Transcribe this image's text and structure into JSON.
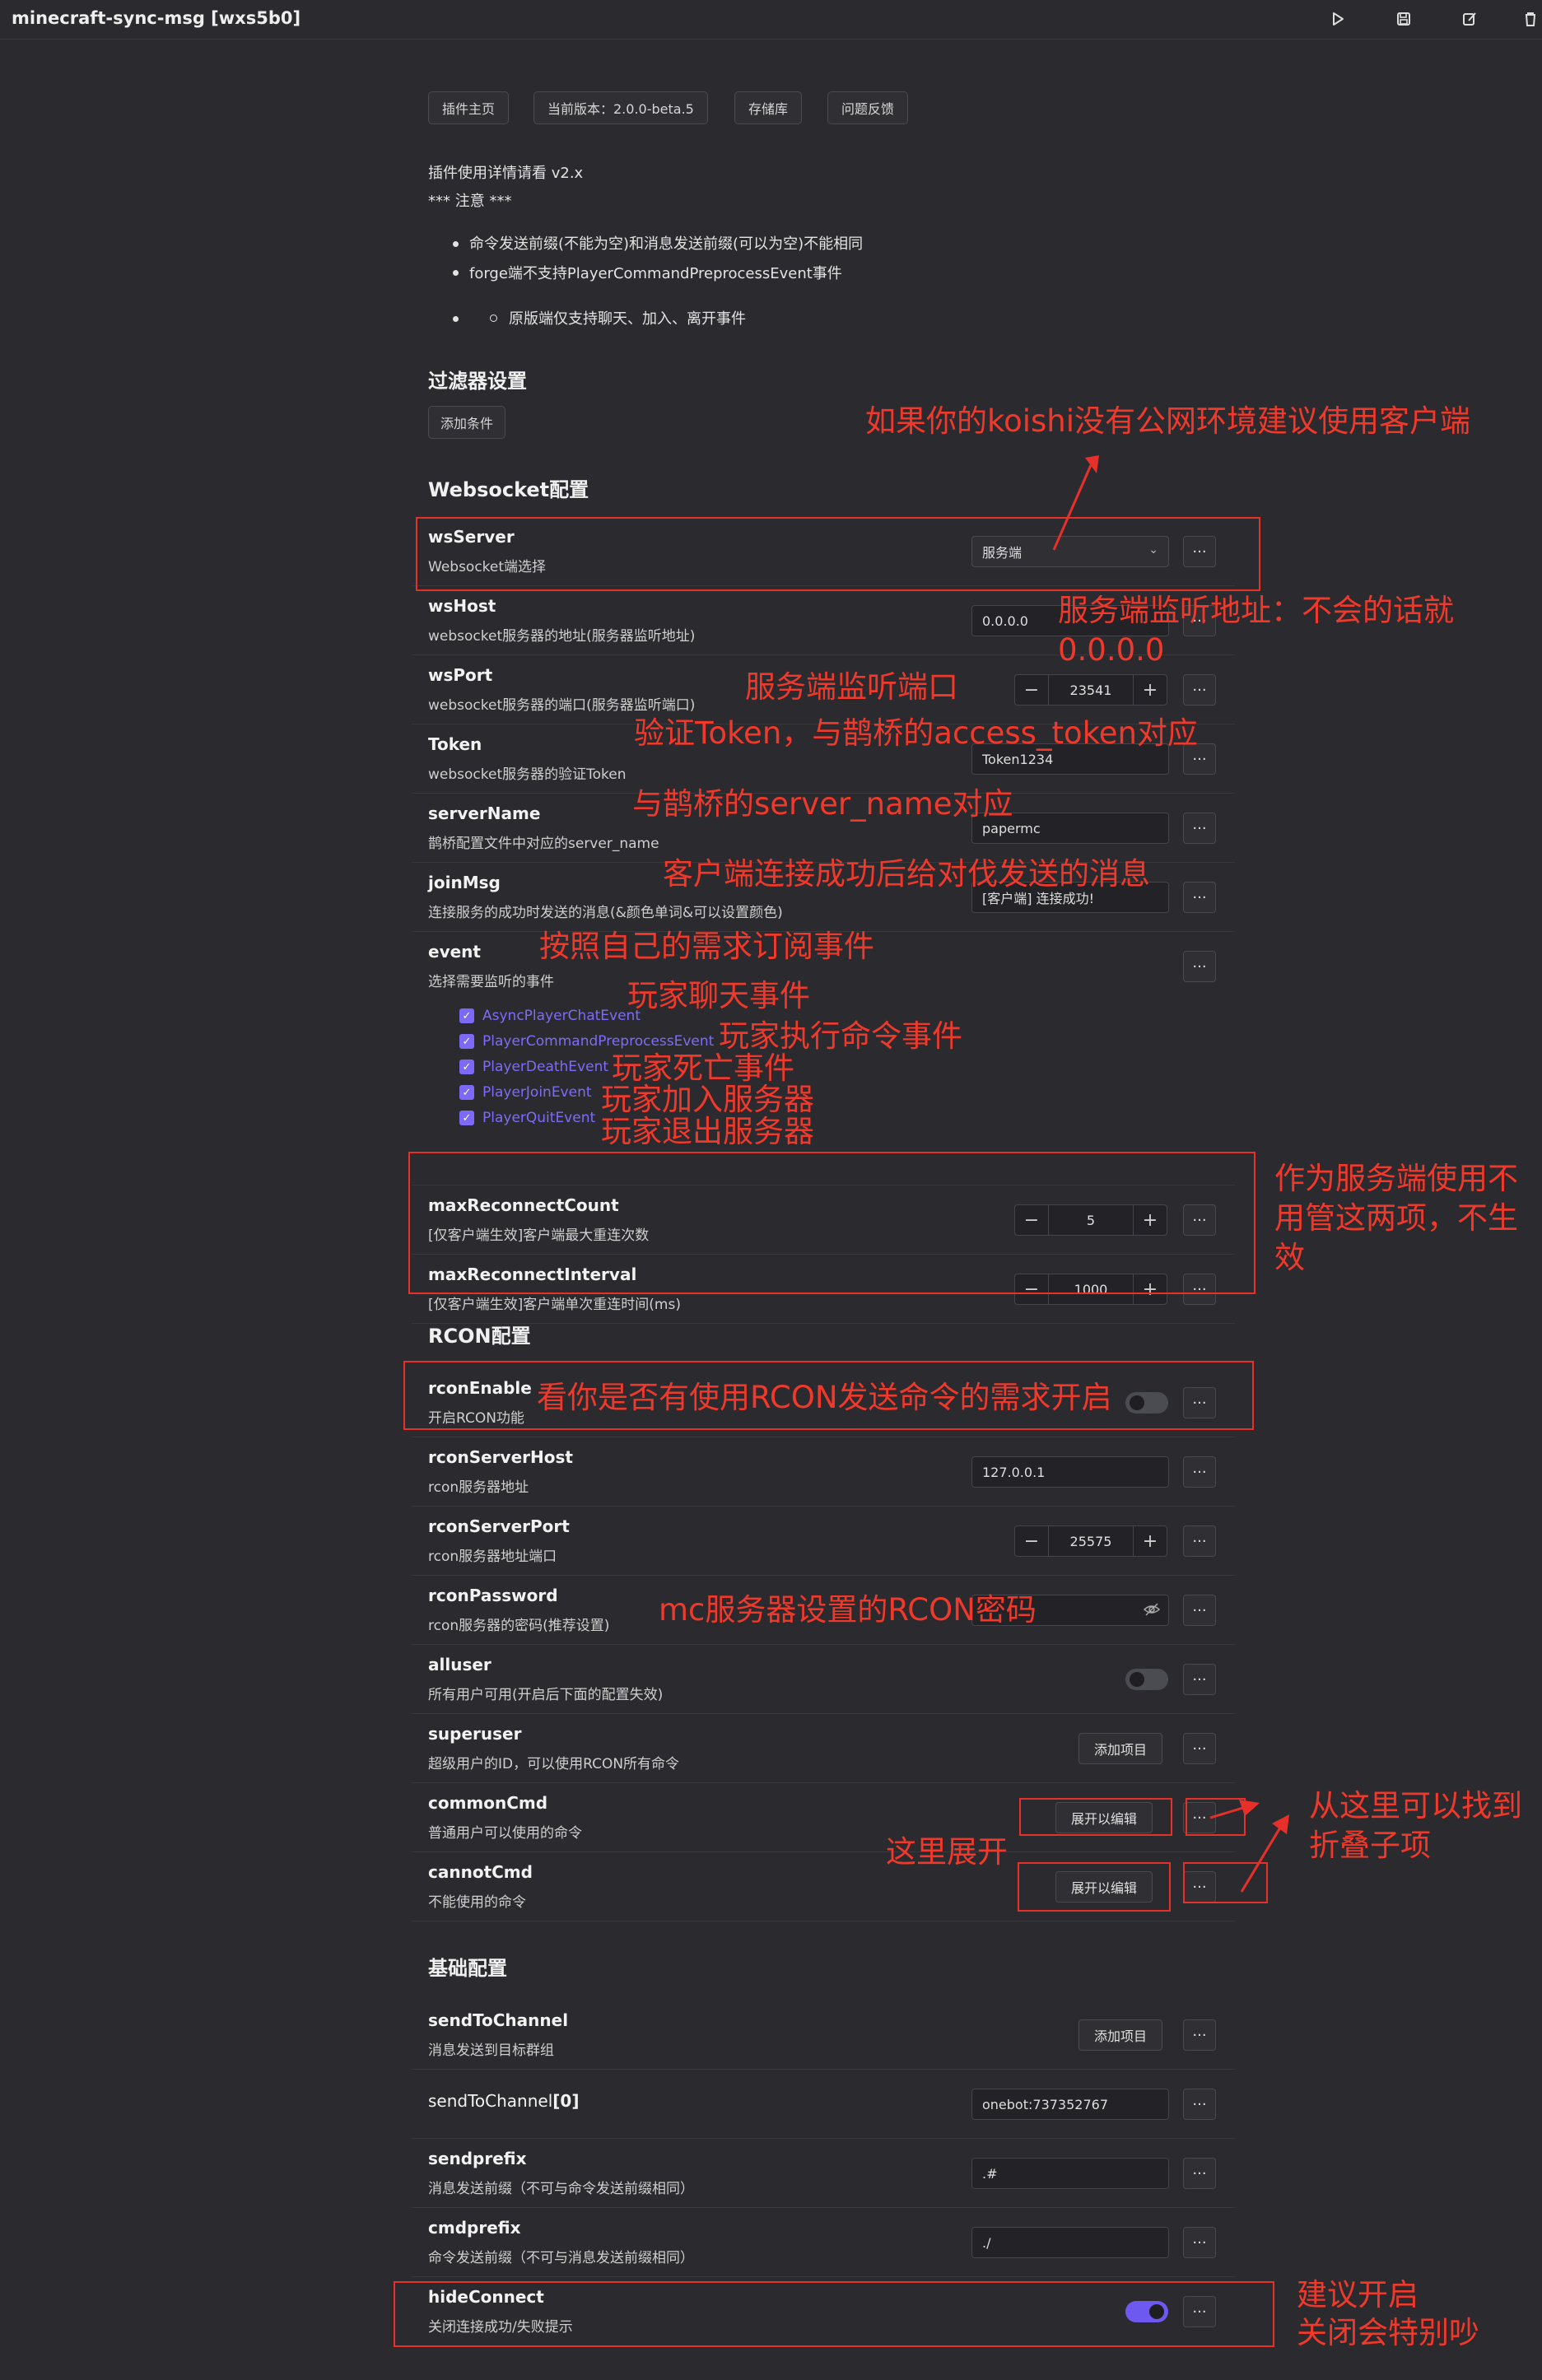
{
  "app": {
    "title": "minecraft-sync-msg [wxs5b0]"
  },
  "toolbar": {
    "run_icon": "play-icon",
    "save_icon": "save-icon",
    "edit_icon": "edit-icon",
    "delete_icon": "trash-icon"
  },
  "header_links": [
    "插件主页",
    "当前版本：2.0.0-beta.5",
    "存储库",
    "问题反馈"
  ],
  "intro": {
    "line1": "插件使用详情请看 v2.x",
    "line2": "*** 注意 ***",
    "bullets": [
      "命令发送前缀(不能为空)和消息发送前缀(可以为空)不能相同",
      "forge端不支持PlayerCommandPreprocessEvent事件"
    ],
    "sub_bullet": "原版端仅支持聊天、加入、离开事件"
  },
  "filter": {
    "title": "过滤器设置",
    "add_condition": "添加条件"
  },
  "websocket": {
    "title": "Websocket配置",
    "wsServer": {
      "name": "wsServer",
      "desc": "Websocket端选择",
      "value": "服务端"
    },
    "wsHost": {
      "name": "wsHost",
      "desc": "websocket服务器的地址(服务器监听地址)",
      "value": "0.0.0.0"
    },
    "wsPort": {
      "name": "wsPort",
      "desc": "websocket服务器的端口(服务器监听端口)",
      "value": "23541"
    },
    "Token": {
      "name": "Token",
      "desc": "websocket服务器的验证Token",
      "value": "Token1234"
    },
    "serverName": {
      "name": "serverName",
      "desc": "鹊桥配置文件中对应的server_name",
      "value": "papermc"
    },
    "joinMsg": {
      "name": "joinMsg",
      "desc": "连接服务的成功时发送的消息(&颜色单词&可以设置颜色)",
      "value": "[客户端] 连接成功!"
    },
    "event": {
      "name": "event",
      "desc": "选择需要监听的事件",
      "options": [
        "AsyncPlayerChatEvent",
        "PlayerCommandPreprocessEvent",
        "PlayerDeathEvent",
        "PlayerJoinEvent",
        "PlayerQuitEvent"
      ]
    },
    "maxReconnectCount": {
      "name": "maxReconnectCount",
      "desc": "[仅客户端生效]客户端最大重连次数",
      "value": "5"
    },
    "maxReconnectInterval": {
      "name": "maxReconnectInterval",
      "desc": "[仅客户端生效]客户端单次重连时间(ms)",
      "value": "1000"
    }
  },
  "rcon": {
    "title": "RCON配置",
    "rconEnable": {
      "name": "rconEnable",
      "desc": "开启RCON功能",
      "on": false
    },
    "rconServerHost": {
      "name": "rconServerHost",
      "desc": "rcon服务器地址",
      "value": "127.0.0.1"
    },
    "rconServerPort": {
      "name": "rconServerPort",
      "desc": "rcon服务器地址端口",
      "value": "25575"
    },
    "rconPassword": {
      "name": "rconPassword",
      "desc": "rcon服务器的密码(推荐设置)"
    },
    "alluser": {
      "name": "alluser",
      "desc": "所有用户可用(开启后下面的配置失效)",
      "on": false
    },
    "superuser": {
      "name": "superuser",
      "desc": "超级用户的ID，可以使用RCON所有命令",
      "button": "添加项目"
    },
    "commonCmd": {
      "name": "commonCmd",
      "desc": "普通用户可以使用的命令",
      "button": "展开以编辑"
    },
    "cannotCmd": {
      "name": "cannotCmd",
      "desc": "不能使用的命令",
      "button": "展开以编辑"
    }
  },
  "basic": {
    "title": "基础配置",
    "sendToChannel": {
      "name": "sendToChannel",
      "desc": "消息发送到目标群组",
      "button": "添加项目"
    },
    "sendToChannel0": {
      "name": "sendToChannel",
      "index": "[0]",
      "value": "onebot:737352767"
    },
    "sendprefix": {
      "name": "sendprefix",
      "desc": "消息发送前缀（不可与命令发送前缀相同）",
      "value": ".#"
    },
    "cmdprefix": {
      "name": "cmdprefix",
      "desc": "命令发送前缀（不可与消息发送前缀相同）",
      "value": "./"
    },
    "hideConnect": {
      "name": "hideConnect",
      "desc": "关闭连接成功/失败提示",
      "on": true
    }
  },
  "more_label": "···",
  "annotations": {
    "a1": "如果你的koishi没有公网环境建议使用客户端",
    "a2": "服务端监听地址：不会的话就",
    "a2b": "0.0.0.0",
    "a3": "服务端监听端口",
    "a4": "验证Token，与鹊桥的access_token对应",
    "a5": "与鹊桥的server_name对应",
    "a6": "客户端连接成功后给对伐发送的消息",
    "a7": "按照自己的需求订阅事件",
    "a8": "玩家聊天事件",
    "a9": "玩家执行命令事件",
    "a10": "玩家死亡事件",
    "a11": "玩家加入服务器",
    "a12": "玩家退出服务器",
    "a13": "作为服务端使用不",
    "a13b": "用管这两项，不生",
    "a13c": "效",
    "a14": "看你是否有使用RCON发送命令的需求开启",
    "a15": "mc服务器设置的RCON密码",
    "a16": "这里展开",
    "a17": "从这里可以找到",
    "a17b": "折叠子项",
    "a18": "建议开启",
    "a18b": "关闭会特别吵"
  },
  "colors": {
    "accent": "#7a6af7",
    "annotation": "#f0392b",
    "background": "#2b2b2f"
  }
}
